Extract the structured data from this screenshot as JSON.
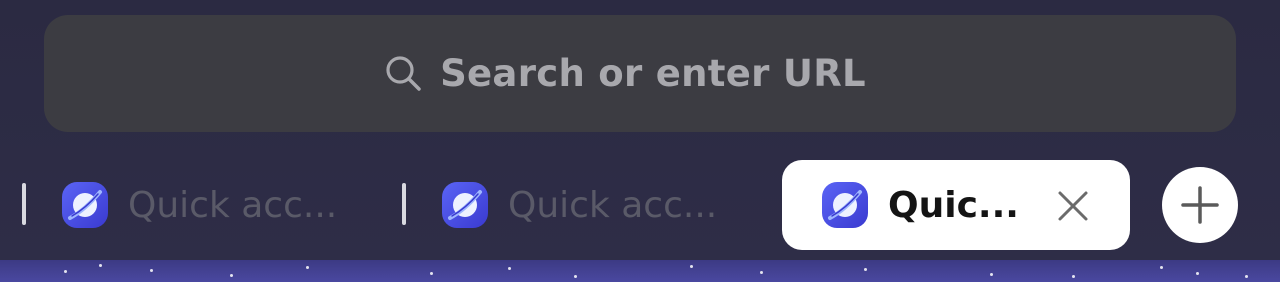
{
  "search": {
    "placeholder": "Search or enter URL"
  },
  "tabs": [
    {
      "label": "Quick acc...",
      "active": false,
      "icon": "internet-globe-icon"
    },
    {
      "label": "Quick acc...",
      "active": false,
      "icon": "internet-globe-icon"
    },
    {
      "label": "Quic...",
      "active": true,
      "icon": "internet-globe-icon"
    }
  ],
  "icons": {
    "search": "search-icon",
    "close": "close-icon",
    "new_tab": "plus-icon"
  },
  "colors": {
    "background": "#2c2b44",
    "search_bar": "#3c3c42",
    "placeholder_text": "#a8a8ad",
    "inactive_tab_text": "#5a5a68",
    "active_tab_bg": "#ffffff",
    "starfield": "#3c3a84"
  }
}
